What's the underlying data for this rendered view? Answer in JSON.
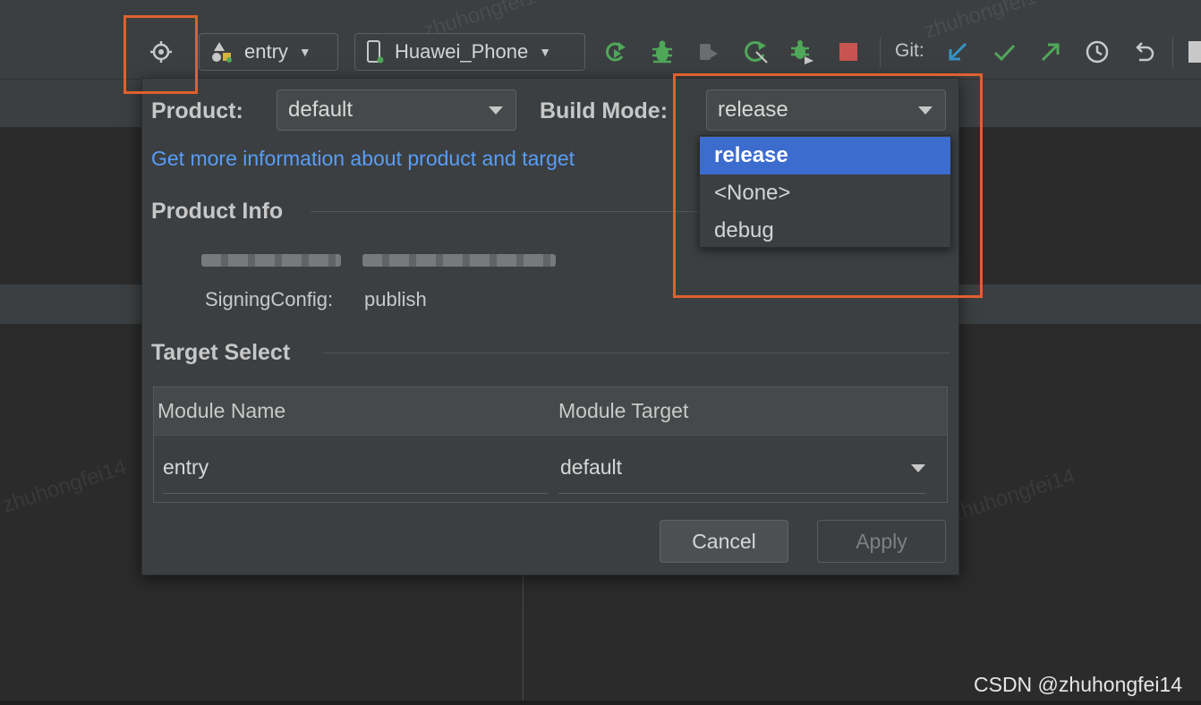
{
  "toolbar": {
    "run_config": "entry",
    "device": "Huawei_Phone",
    "git_label": "Git:",
    "icons": [
      "target-icon",
      "run-icon",
      "debug-icon",
      "attach-icon",
      "rerun-icon",
      "attach-debugger-icon",
      "stop-icon",
      "git-update-icon",
      "git-commit-icon",
      "git-push-icon",
      "history-icon",
      "rollback-icon"
    ]
  },
  "dialog": {
    "product_label": "Product:",
    "product_value": "default",
    "build_mode_label": "Build Mode:",
    "build_mode_value": "release",
    "info_link": "Get more information about product and target",
    "product_info_title": "Product Info",
    "signing_key": "SigningConfig:",
    "signing_value": "publish",
    "target_select_title": "Target Select",
    "table": {
      "headers": [
        "Module Name",
        "Module Target"
      ],
      "rows": [
        {
          "module_name": "entry",
          "module_target": "default"
        }
      ]
    },
    "cancel_label": "Cancel",
    "apply_label": "Apply"
  },
  "build_mode_options": [
    "release",
    "<None>",
    "debug"
  ],
  "watermark": "CSDN @zhuhongfei14",
  "colors": {
    "highlight": "#e0602e",
    "selection": "#3d6ccf",
    "link": "#589df6",
    "green": "#4fa85a",
    "blue": "#3592c4",
    "red": "#c75450"
  }
}
